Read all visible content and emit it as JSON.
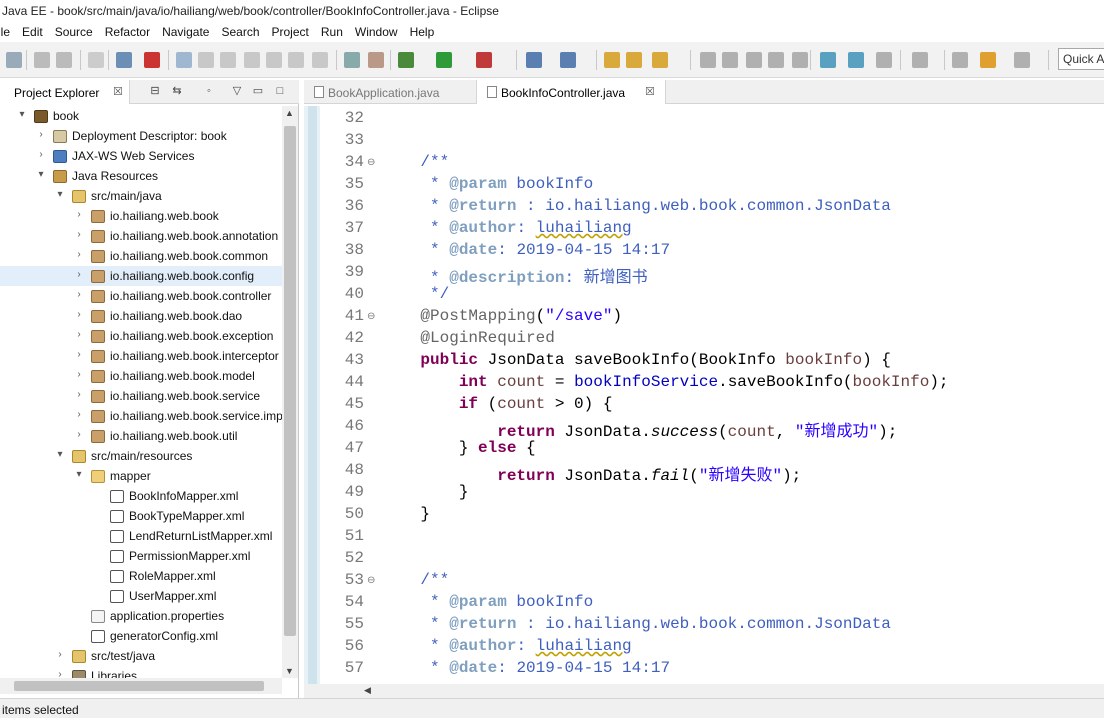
{
  "window": {
    "title": "Java EE - book/src/main/java/io/hailiang/web/book/controller/BookInfoController.java - Eclipse"
  },
  "menu": [
    "ile",
    "Edit",
    "Source",
    "Refactor",
    "Navigate",
    "Search",
    "Project",
    "Run",
    "Window",
    "Help"
  ],
  "toolbar": {
    "quick_access": "Quick A"
  },
  "explorer": {
    "tab_label": "Project Explorer",
    "close_glyph": "☒",
    "tree": [
      {
        "label": "book",
        "icon": "project-icon",
        "arrow": "▾",
        "level": 0
      },
      {
        "label": "Deployment Descriptor: book",
        "icon": "descriptor-icon",
        "arrow": "›",
        "level": 1
      },
      {
        "label": "JAX-WS Web Services",
        "icon": "web-services-icon",
        "arrow": "›",
        "level": 1
      },
      {
        "label": "Java Resources",
        "icon": "java-resources-icon",
        "arrow": "▾",
        "level": 1
      },
      {
        "label": "src/main/java",
        "icon": "source-folder-icon",
        "arrow": "▾",
        "level": 2
      },
      {
        "label": "io.hailiang.web.book",
        "icon": "package-icon",
        "arrow": "›",
        "level": 3
      },
      {
        "label": "io.hailiang.web.book.annotation",
        "icon": "package-icon",
        "arrow": "›",
        "level": 3
      },
      {
        "label": "io.hailiang.web.book.common",
        "icon": "package-icon",
        "arrow": "›",
        "level": 3
      },
      {
        "label": "io.hailiang.web.book.config",
        "icon": "package-icon",
        "arrow": "›",
        "level": 3,
        "selected": true
      },
      {
        "label": "io.hailiang.web.book.controller",
        "icon": "package-icon",
        "arrow": "›",
        "level": 3
      },
      {
        "label": "io.hailiang.web.book.dao",
        "icon": "package-icon",
        "arrow": "›",
        "level": 3
      },
      {
        "label": "io.hailiang.web.book.exception",
        "icon": "package-icon",
        "arrow": "›",
        "level": 3
      },
      {
        "label": "io.hailiang.web.book.interceptor",
        "icon": "package-icon",
        "arrow": "›",
        "level": 3
      },
      {
        "label": "io.hailiang.web.book.model",
        "icon": "package-icon",
        "arrow": "›",
        "level": 3
      },
      {
        "label": "io.hailiang.web.book.service",
        "icon": "package-icon",
        "arrow": "›",
        "level": 3
      },
      {
        "label": "io.hailiang.web.book.service.imp",
        "icon": "package-icon",
        "arrow": "›",
        "level": 3
      },
      {
        "label": "io.hailiang.web.book.util",
        "icon": "package-icon",
        "arrow": "›",
        "level": 3
      },
      {
        "label": "src/main/resources",
        "icon": "source-folder-icon",
        "arrow": "▾",
        "level": 2
      },
      {
        "label": "mapper",
        "icon": "folder-icon",
        "arrow": "▾",
        "level": 3
      },
      {
        "label": "BookInfoMapper.xml",
        "icon": "xml-file-icon",
        "arrow": "",
        "level": 4
      },
      {
        "label": "BookTypeMapper.xml",
        "icon": "xml-file-icon",
        "arrow": "",
        "level": 4
      },
      {
        "label": "LendReturnListMapper.xml",
        "icon": "xml-file-icon",
        "arrow": "",
        "level": 4
      },
      {
        "label": "PermissionMapper.xml",
        "icon": "xml-file-icon",
        "arrow": "",
        "level": 4
      },
      {
        "label": "RoleMapper.xml",
        "icon": "xml-file-icon",
        "arrow": "",
        "level": 4
      },
      {
        "label": "UserMapper.xml",
        "icon": "xml-file-icon",
        "arrow": "",
        "level": 4
      },
      {
        "label": "application.properties",
        "icon": "properties-file-icon",
        "arrow": "",
        "level": 3
      },
      {
        "label": "generatorConfig.xml",
        "icon": "xml-file-icon",
        "arrow": "",
        "level": 3
      },
      {
        "label": "src/test/java",
        "icon": "source-folder-icon",
        "arrow": "›",
        "level": 2
      },
      {
        "label": "Libraries",
        "icon": "library-icon",
        "arrow": "›",
        "level": 2
      }
    ]
  },
  "editor": {
    "tabs": [
      {
        "label": "BookApplication.java",
        "active": false
      },
      {
        "label": "BookInfoController.java",
        "active": true
      }
    ],
    "close_glyph": "☒",
    "lines": [
      {
        "n": "32",
        "fold": "",
        "segs": []
      },
      {
        "n": "33",
        "fold": "",
        "segs": []
      },
      {
        "n": "34",
        "fold": "⊖",
        "segs": [
          {
            "t": "    /**",
            "c": "c-comment"
          }
        ]
      },
      {
        "n": "35",
        "fold": "",
        "segs": [
          {
            "t": "     * ",
            "c": "c-comment"
          },
          {
            "t": "@param",
            "c": "c-tag"
          },
          {
            "t": " bookInfo",
            "c": "c-comment"
          }
        ]
      },
      {
        "n": "36",
        "fold": "",
        "segs": [
          {
            "t": "     * ",
            "c": "c-comment"
          },
          {
            "t": "@return",
            "c": "c-tag"
          },
          {
            "t": " : io.hailiang.web.book.common.JsonData",
            "c": "c-comment"
          }
        ]
      },
      {
        "n": "37",
        "fold": "",
        "segs": [
          {
            "t": "     * ",
            "c": "c-comment"
          },
          {
            "t": "@author",
            "c": "c-tag"
          },
          {
            "t": ": ",
            "c": "c-comment"
          },
          {
            "t": "luhailiang",
            "c": "c-comment c-under"
          }
        ]
      },
      {
        "n": "38",
        "fold": "",
        "segs": [
          {
            "t": "     * ",
            "c": "c-comment"
          },
          {
            "t": "@date",
            "c": "c-tag"
          },
          {
            "t": ": 2019-04-15 14:17",
            "c": "c-comment"
          }
        ]
      },
      {
        "n": "39",
        "fold": "",
        "segs": [
          {
            "t": "     * ",
            "c": "c-comment"
          },
          {
            "t": "@description",
            "c": "c-tag"
          },
          {
            "t": ": 新增图书",
            "c": "c-comment"
          }
        ]
      },
      {
        "n": "40",
        "fold": "",
        "segs": [
          {
            "t": "     */",
            "c": "c-comment"
          }
        ]
      },
      {
        "n": "41",
        "fold": "⊖",
        "segs": [
          {
            "t": "    @PostMapping",
            "c": "c-anno"
          },
          {
            "t": "(",
            "c": ""
          },
          {
            "t": "\"/save\"",
            "c": "c-str"
          },
          {
            "t": ")",
            "c": ""
          }
        ]
      },
      {
        "n": "42",
        "fold": "",
        "segs": [
          {
            "t": "    @LoginRequired",
            "c": "c-anno"
          }
        ]
      },
      {
        "n": "43",
        "fold": "",
        "segs": [
          {
            "t": "    ",
            "c": ""
          },
          {
            "t": "public",
            "c": "c-kw"
          },
          {
            "t": " JsonData saveBookInfo(BookInfo ",
            "c": ""
          },
          {
            "t": "bookInfo",
            "c": "c-param"
          },
          {
            "t": ") {",
            "c": ""
          }
        ]
      },
      {
        "n": "44",
        "fold": "",
        "segs": [
          {
            "t": "        ",
            "c": ""
          },
          {
            "t": "int",
            "c": "c-kw"
          },
          {
            "t": " ",
            "c": ""
          },
          {
            "t": "count",
            "c": "c-param"
          },
          {
            "t": " = ",
            "c": ""
          },
          {
            "t": "bookInfoService",
            "c": "c-field"
          },
          {
            "t": ".saveBookInfo(",
            "c": ""
          },
          {
            "t": "bookInfo",
            "c": "c-param"
          },
          {
            "t": ");",
            "c": ""
          }
        ]
      },
      {
        "n": "45",
        "fold": "",
        "segs": [
          {
            "t": "        ",
            "c": ""
          },
          {
            "t": "if",
            "c": "c-kw"
          },
          {
            "t": " (",
            "c": ""
          },
          {
            "t": "count",
            "c": "c-param"
          },
          {
            "t": " > 0) {",
            "c": ""
          }
        ]
      },
      {
        "n": "46",
        "fold": "",
        "segs": [
          {
            "t": "            ",
            "c": ""
          },
          {
            "t": "return",
            "c": "c-kw"
          },
          {
            "t": " JsonData.",
            "c": ""
          },
          {
            "t": "success",
            "c": "c-italic"
          },
          {
            "t": "(",
            "c": ""
          },
          {
            "t": "count",
            "c": "c-param"
          },
          {
            "t": ", ",
            "c": ""
          },
          {
            "t": "\"新增成功\"",
            "c": "c-str"
          },
          {
            "t": ");",
            "c": ""
          }
        ]
      },
      {
        "n": "47",
        "fold": "",
        "segs": [
          {
            "t": "        } ",
            "c": ""
          },
          {
            "t": "else",
            "c": "c-kw"
          },
          {
            "t": " {",
            "c": ""
          }
        ]
      },
      {
        "n": "48",
        "fold": "",
        "segs": [
          {
            "t": "            ",
            "c": ""
          },
          {
            "t": "return",
            "c": "c-kw"
          },
          {
            "t": " JsonData.",
            "c": ""
          },
          {
            "t": "fail",
            "c": "c-italic"
          },
          {
            "t": "(",
            "c": ""
          },
          {
            "t": "\"新增失败\"",
            "c": "c-str"
          },
          {
            "t": ");",
            "c": ""
          }
        ]
      },
      {
        "n": "49",
        "fold": "",
        "segs": [
          {
            "t": "        }",
            "c": ""
          }
        ]
      },
      {
        "n": "50",
        "fold": "",
        "segs": [
          {
            "t": "    }",
            "c": ""
          }
        ]
      },
      {
        "n": "51",
        "fold": "",
        "segs": []
      },
      {
        "n": "52",
        "fold": "",
        "segs": []
      },
      {
        "n": "53",
        "fold": "⊖",
        "segs": [
          {
            "t": "    /**",
            "c": "c-comment"
          }
        ]
      },
      {
        "n": "54",
        "fold": "",
        "segs": [
          {
            "t": "     * ",
            "c": "c-comment"
          },
          {
            "t": "@param",
            "c": "c-tag"
          },
          {
            "t": " bookInfo",
            "c": "c-comment"
          }
        ]
      },
      {
        "n": "55",
        "fold": "",
        "segs": [
          {
            "t": "     * ",
            "c": "c-comment"
          },
          {
            "t": "@return",
            "c": "c-tag"
          },
          {
            "t": " : io.hailiang.web.book.common.JsonData",
            "c": "c-comment"
          }
        ]
      },
      {
        "n": "56",
        "fold": "",
        "segs": [
          {
            "t": "     * ",
            "c": "c-comment"
          },
          {
            "t": "@author",
            "c": "c-tag"
          },
          {
            "t": ": ",
            "c": "c-comment"
          },
          {
            "t": "luhailiang",
            "c": "c-comment c-under"
          }
        ]
      },
      {
        "n": "57",
        "fold": "",
        "segs": [
          {
            "t": "     * ",
            "c": "c-comment"
          },
          {
            "t": "@date",
            "c": "c-tag"
          },
          {
            "t": ": 2019-04-15 14:17",
            "c": "c-comment"
          }
        ]
      }
    ]
  },
  "status": {
    "text": "items selected"
  }
}
